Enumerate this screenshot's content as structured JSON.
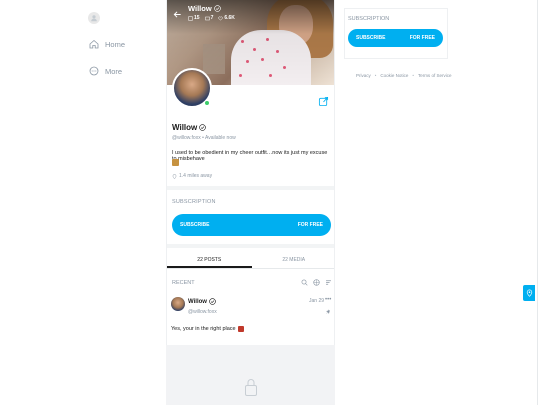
{
  "nav": {
    "items": [
      {
        "label": "Home",
        "icon": "home-icon"
      },
      {
        "label": "More",
        "icon": "more-icon"
      }
    ]
  },
  "profile": {
    "cover_name": "Willow",
    "stats": {
      "photos": "15",
      "videos": "7",
      "likes": "6.6K"
    },
    "name": "Willow",
    "handle": "@willow.foxx",
    "status": "Available now",
    "bio": "I used to be obedient in my cheer outfit…now its just my excuse to misbehave",
    "location": "1.4 miles away"
  },
  "subscription": {
    "label": "SUBSCRIPTION",
    "button_left": "SUBSCRIBE",
    "button_right": "FOR FREE"
  },
  "tabs": [
    {
      "label": "22 POSTS",
      "active": true
    },
    {
      "label": "22 MEDIA",
      "active": false
    }
  ],
  "recent": {
    "label": "RECENT"
  },
  "post": {
    "name": "Willow",
    "handle": "@willow.foxx",
    "date": "Jan 29",
    "more": "•••",
    "text": "Yes, your in the right place"
  },
  "footer": {
    "links": [
      "Privacy",
      "Cookie Notice",
      "Terms of Service"
    ],
    "separator": "•"
  },
  "colors": {
    "accent": "#00aff0",
    "muted": "#8a96a3",
    "online": "#3ccd6a"
  }
}
